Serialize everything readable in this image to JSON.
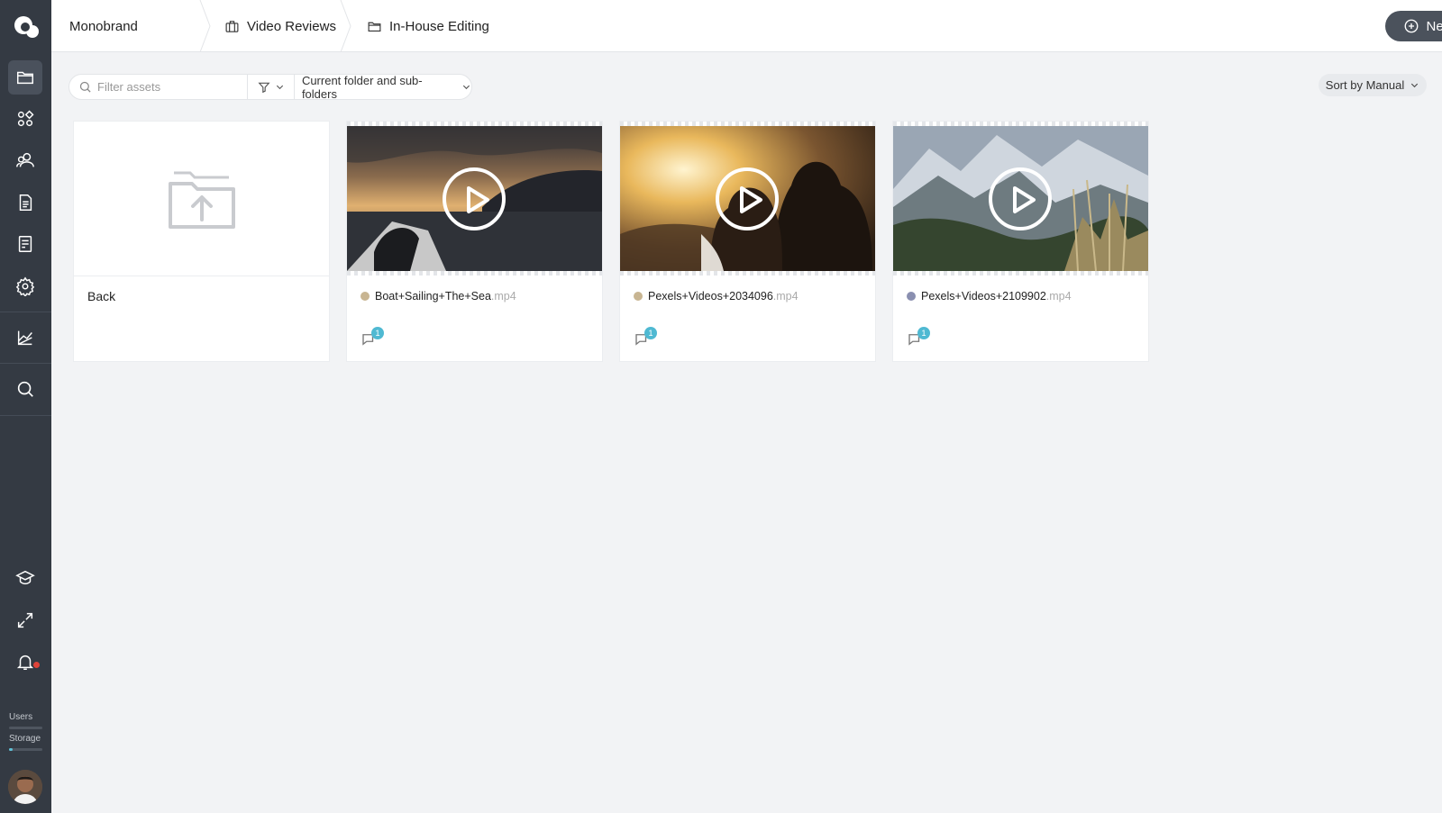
{
  "sidebar": {
    "nav": [
      {
        "icon": "folder-icon",
        "active": true
      },
      {
        "icon": "apps-icon"
      },
      {
        "icon": "users-icon"
      },
      {
        "icon": "document-icon"
      },
      {
        "icon": "checklist-icon"
      },
      {
        "icon": "gear-icon"
      },
      {
        "icon": "chart-icon"
      },
      {
        "icon": "search-icon"
      }
    ],
    "bottom": [
      {
        "icon": "graduation-cap-icon"
      },
      {
        "icon": "expand-icon"
      },
      {
        "icon": "bell-icon"
      }
    ],
    "users_label": "Users",
    "storage_label": "Storage",
    "users_usage": 0,
    "storage_usage": 0.12
  },
  "breadcrumb": {
    "items": [
      {
        "label": "Monobrand",
        "icon": ""
      },
      {
        "label": "Video Reviews",
        "icon": "briefcase-icon"
      },
      {
        "label": "In-House Editing",
        "icon": "folder-icon"
      }
    ]
  },
  "header": {
    "new_label": "New"
  },
  "toolbar": {
    "filter_placeholder": "Filter assets",
    "scope_label": "Current folder and sub-folders",
    "sort_label": "Sort by Manual"
  },
  "back_card": {
    "label": "Back"
  },
  "assets": [
    {
      "name": "Boat+Sailing+The+Sea",
      "ext": ".mp4",
      "status_color": "#c8b592",
      "comments": "1"
    },
    {
      "name": "Pexels+Videos+2034096",
      "ext": ".mp4",
      "status_color": "#c8b592",
      "comments": "1"
    },
    {
      "name": "Pexels+Videos+2109902",
      "ext": ".mp4",
      "status_color": "#8a8fb0",
      "comments": "1"
    }
  ],
  "colors": {
    "sidebar_bg": "#343a43",
    "accent": "#4fb9d2",
    "notification": "#e0443a"
  }
}
